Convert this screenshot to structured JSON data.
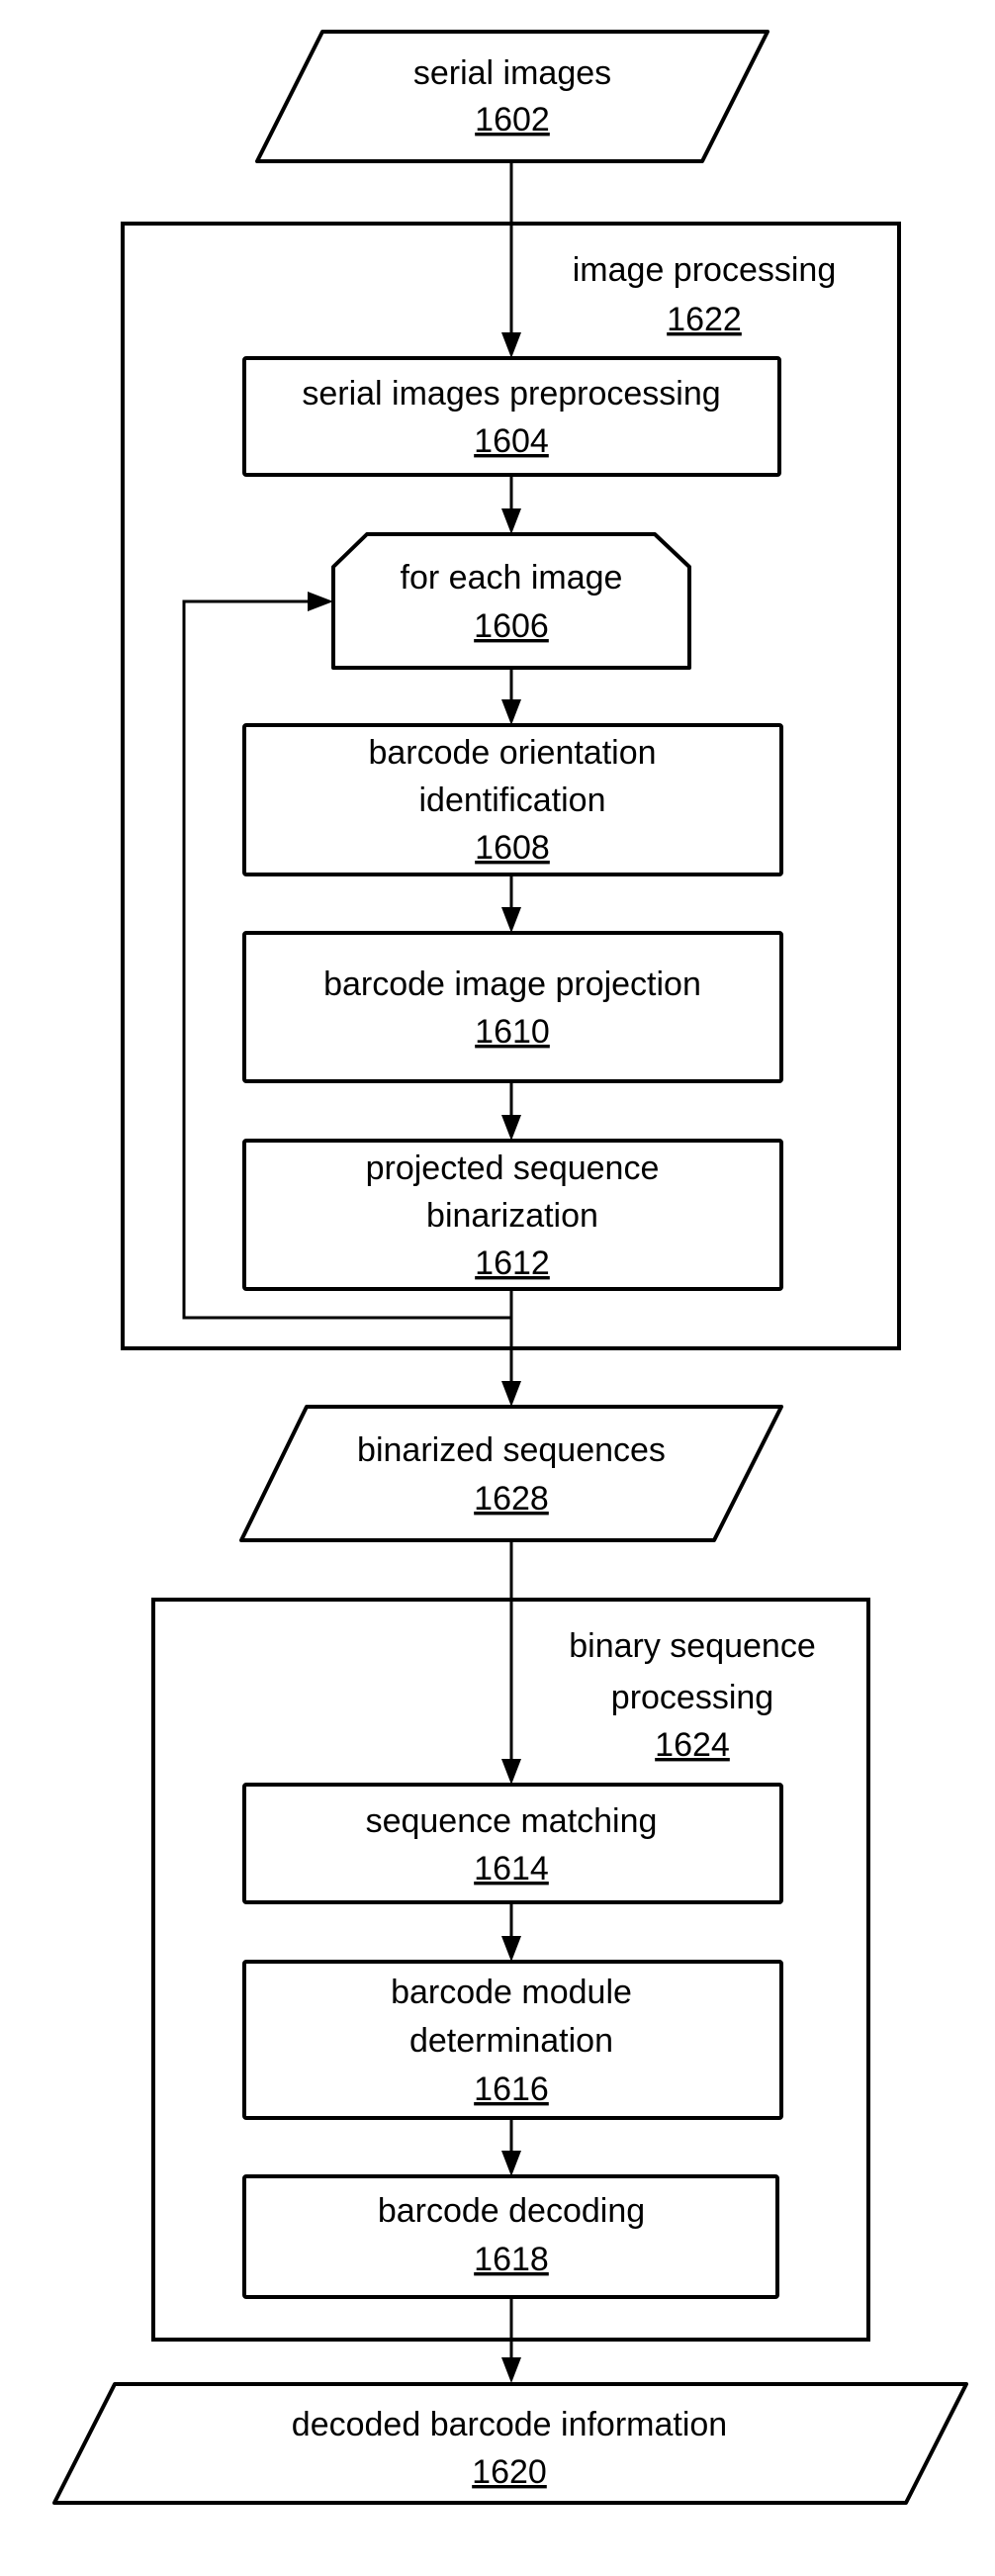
{
  "figure": {
    "type": "flowchart",
    "nodes": [
      {
        "id": "1602",
        "shape": "data",
        "lines": [
          "serial images"
        ],
        "ref": "1602"
      },
      {
        "id": "1604",
        "shape": "process",
        "lines": [
          "serial images preprocessing"
        ],
        "ref": "1604"
      },
      {
        "id": "1606",
        "shape": "loop-start",
        "lines": [
          "for each image"
        ],
        "ref": "1606"
      },
      {
        "id": "1608",
        "shape": "process",
        "lines": [
          "barcode orientation",
          "identification"
        ],
        "ref": "1608"
      },
      {
        "id": "1610",
        "shape": "process",
        "lines": [
          "barcode image projection"
        ],
        "ref": "1610"
      },
      {
        "id": "1612",
        "shape": "process",
        "lines": [
          "projected sequence",
          "binarization"
        ],
        "ref": "1612"
      },
      {
        "id": "1628",
        "shape": "data",
        "lines": [
          "binarized sequences"
        ],
        "ref": "1628"
      },
      {
        "id": "1614",
        "shape": "process",
        "lines": [
          "sequence matching"
        ],
        "ref": "1614"
      },
      {
        "id": "1616",
        "shape": "process",
        "lines": [
          "barcode module",
          "determination"
        ],
        "ref": "1616"
      },
      {
        "id": "1618",
        "shape": "process",
        "lines": [
          "barcode decoding"
        ],
        "ref": "1618"
      },
      {
        "id": "1620",
        "shape": "data",
        "lines": [
          "decoded barcode information"
        ],
        "ref": "1620"
      }
    ],
    "groups": [
      {
        "id": "1622",
        "lines": [
          "image processing"
        ],
        "ref": "1622",
        "contains": [
          "1604",
          "1606",
          "1608",
          "1610",
          "1612"
        ]
      },
      {
        "id": "1624",
        "lines": [
          "binary sequence",
          "processing"
        ],
        "ref": "1624",
        "contains": [
          "1614",
          "1616",
          "1618"
        ]
      }
    ],
    "edges": [
      {
        "from": "1602",
        "to": "1604"
      },
      {
        "from": "1604",
        "to": "1606"
      },
      {
        "from": "1606",
        "to": "1608"
      },
      {
        "from": "1608",
        "to": "1610"
      },
      {
        "from": "1610",
        "to": "1612"
      },
      {
        "from": "1612",
        "to": "1606",
        "kind": "loop-back"
      },
      {
        "from": "1612",
        "to": "1628"
      },
      {
        "from": "1628",
        "to": "1614"
      },
      {
        "from": "1614",
        "to": "1616"
      },
      {
        "from": "1616",
        "to": "1618"
      },
      {
        "from": "1618",
        "to": "1620"
      }
    ]
  }
}
